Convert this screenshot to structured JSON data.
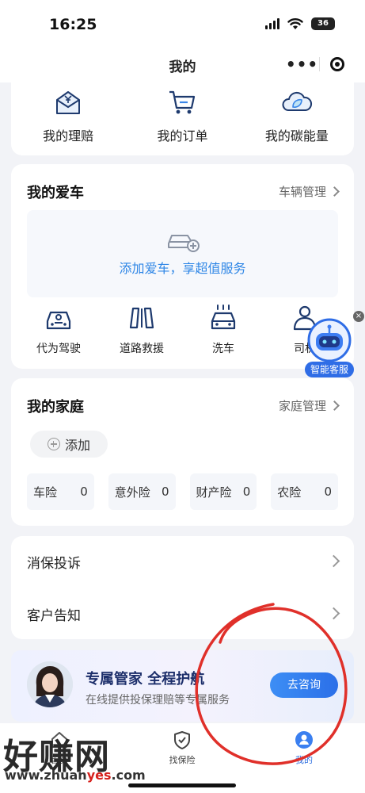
{
  "status_bar": {
    "time": "16:25",
    "battery": "36"
  },
  "nav": {
    "title": "我的"
  },
  "quick_actions": [
    {
      "label": "我的理赔",
      "icon": "claim-envelope-icon"
    },
    {
      "label": "我的订单",
      "icon": "cart-icon"
    },
    {
      "label": "我的碳能量",
      "icon": "leaf-cloud-icon"
    }
  ],
  "car": {
    "title": "我的爱车",
    "manage_link": "车辆管理",
    "add_text": "添加爱车，享超值服务",
    "services": [
      {
        "label": "代为驾驶",
        "icon": "chauffeur-car-icon"
      },
      {
        "label": "道路救援",
        "icon": "road-rescue-icon"
      },
      {
        "label": "洗车",
        "icon": "car-wash-icon"
      },
      {
        "label": "司机",
        "icon": "driver-icon"
      }
    ]
  },
  "family": {
    "title": "我的家庭",
    "manage_link": "家庭管理",
    "add_label": "添加",
    "stats": [
      {
        "label": "车险",
        "value": "0"
      },
      {
        "label": "意外险",
        "value": "0"
      },
      {
        "label": "财产险",
        "value": "0"
      },
      {
        "label": "农险",
        "value": "0"
      }
    ]
  },
  "menu": [
    {
      "label": "消保投诉"
    },
    {
      "label": "客户告知"
    }
  ],
  "banner": {
    "title": "专属管家  全程护航",
    "subtitle": "在线提供投保理赔等专属服务",
    "button": "去咨询"
  },
  "assistant": {
    "label": "智能客服"
  },
  "tabs": [
    {
      "label": "首页"
    },
    {
      "label": "找保险"
    },
    {
      "label": "我的"
    }
  ],
  "watermark": {
    "text": "好赚网",
    "url_prefix": "www.zhuan",
    "url_red": "yes",
    "url_suffix": ".com"
  },
  "colors": {
    "accent": "#2e86e6",
    "banner_title": "#1d2f6b",
    "button": "#2b6fe8",
    "annotation": "#e0302a"
  }
}
